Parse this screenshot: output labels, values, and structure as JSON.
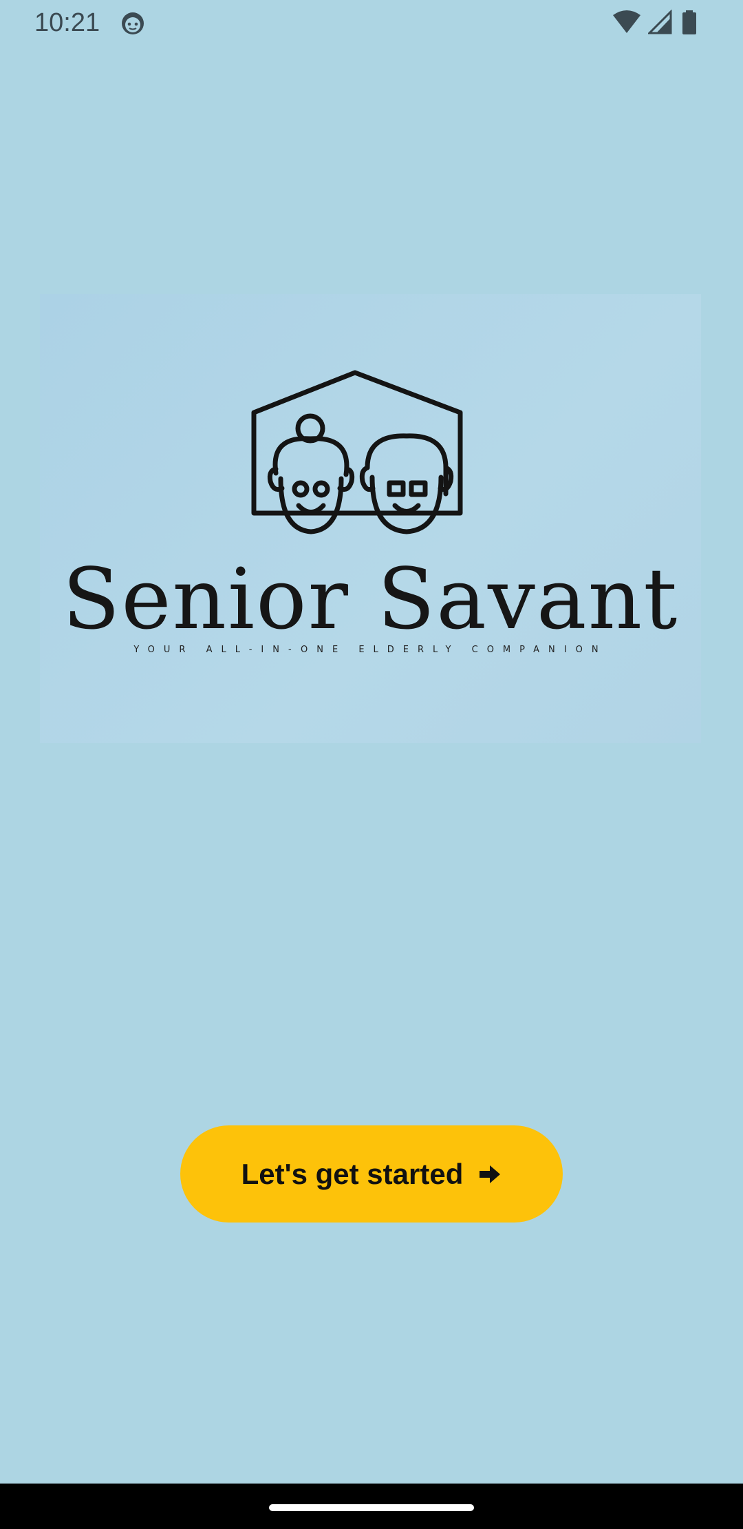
{
  "status_bar": {
    "time": "10:21",
    "app_icon": "android-face-icon",
    "icons": [
      "wifi-icon",
      "cell-signal-icon",
      "battery-icon"
    ]
  },
  "logo": {
    "name": "Senior Savant",
    "tagline": "YOUR ALL-IN-ONE ELDERLY COMPANION",
    "icon": "house-with-elderly-couple-icon"
  },
  "cta": {
    "label": "Let's get started",
    "icon": "arrow-right-icon",
    "color": "#fdc20a"
  },
  "colors": {
    "background": "#add5e3",
    "logo_panel": "#b3d7e8",
    "nav_bar": "#000000"
  }
}
